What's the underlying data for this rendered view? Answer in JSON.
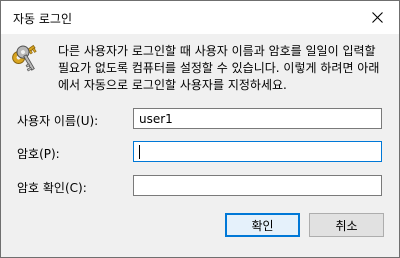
{
  "window": {
    "title": "자동 로그인",
    "close_icon": "close-icon"
  },
  "icon": "keys-icon",
  "description": "다른 사용자가 로그인할 때 사용자 이름과 암호를 일일이 입력할 필요가 없도록 컴퓨터를 설정할 수 있습니다. 이렇게 하려면 아래에서 자동으로 로그인할 사용자를 지정하세요.",
  "fields": {
    "username": {
      "label": "사용자 이름(U):",
      "value": "user1"
    },
    "password": {
      "label": "암호(P):",
      "value": ""
    },
    "confirm": {
      "label": "암호 확인(C):",
      "value": ""
    }
  },
  "buttons": {
    "ok": "확인",
    "cancel": "취소"
  },
  "colors": {
    "accent": "#0078d7",
    "background": "#f0f0f0"
  }
}
